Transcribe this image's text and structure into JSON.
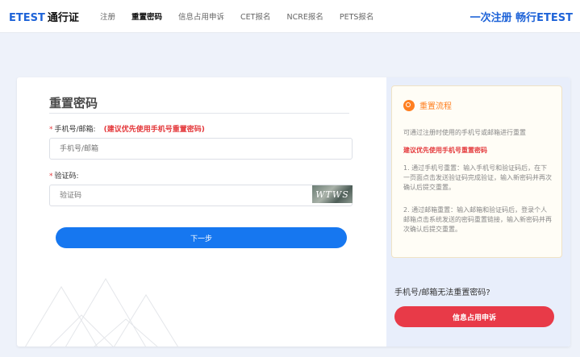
{
  "header": {
    "brand_en": "ETEST",
    "brand_cn": "通行证",
    "nav": [
      "注册",
      "重置密码",
      "信息占用申诉",
      "CET报名",
      "NCRE报名",
      "PETS报名"
    ],
    "active_index": 1,
    "slogan": "一次注册 畅行ETEST"
  },
  "form": {
    "title": "重置密码",
    "account_label": "手机号/邮箱:",
    "account_star": "*",
    "account_hint": "(建议优先使用手机号重置密码)",
    "account_placeholder": "手机号/邮箱",
    "code_label": "验证码:",
    "code_star": "*",
    "code_placeholder": "验证码",
    "captcha_text": "WTWS",
    "next_button": "下一步"
  },
  "side": {
    "process_title": "重置流程",
    "intro": "可通过注册时使用的手机号或邮箱进行重置",
    "recommend": "建议优先使用手机号重置密码",
    "step1": "1. 通过手机号重置：输入手机号和验证码后，在下一页面点击发送验证码完成验证，输入新密码并再次确认后提交重置。",
    "step2": "2. 通过邮箱重置：输入邮箱和验证码后，登录个人邮箱点击系统发送的密码重置链接，输入新密码并再次确认后提交重置。",
    "question": "手机号/邮箱无法重置密码?",
    "appeal_button": "信息占用申诉"
  },
  "colors": {
    "primary": "#1677f0",
    "brand": "#1e63d8",
    "danger": "#e83a48",
    "accent": "#ff7f20",
    "background": "#eef2fa"
  }
}
